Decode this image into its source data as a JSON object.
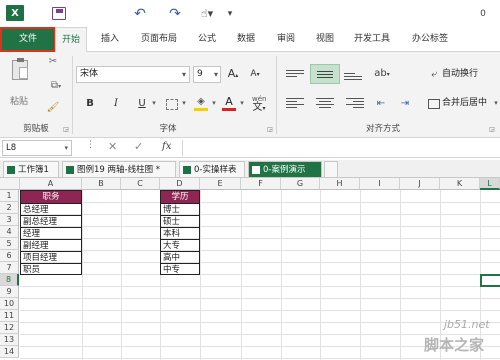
{
  "app": {
    "logo": "X",
    "qat_icons": [
      "save-icon",
      "undo-icon",
      "redo-icon",
      "touch-mode-icon",
      "customize-qat-icon"
    ],
    "qat_right": "0"
  },
  "tabs": [
    {
      "label": "文件"
    },
    {
      "label": "开始"
    },
    {
      "label": "插入"
    },
    {
      "label": "页面布局"
    },
    {
      "label": "公式"
    },
    {
      "label": "数据"
    },
    {
      "label": "审阅"
    },
    {
      "label": "视图"
    },
    {
      "label": "开发工具"
    },
    {
      "label": "办公标签"
    }
  ],
  "ribbon": {
    "clipboard": {
      "paste": "粘贴",
      "label": "剪贴板"
    },
    "font": {
      "name": "宋体",
      "size": "9",
      "grow": "A",
      "shrink": "A",
      "bold": "B",
      "italic": "I",
      "underline": "U",
      "wen": "wén",
      "color_a": "A",
      "label": "字体",
      "fill_color": "#f5d000",
      "font_color": "#e0201e"
    },
    "alignment": {
      "wrap": "自动换行",
      "merge": "合并后居中",
      "label": "对齐方式"
    }
  },
  "formula_bar": {
    "name_box": "L8",
    "fx": "fx",
    "value": ""
  },
  "sheet_tabs": [
    {
      "label": "工作簿1"
    },
    {
      "label": "图例19 两轴-线柱图 *"
    },
    {
      "label": "0-实操样表"
    },
    {
      "label": "0-案例演示"
    }
  ],
  "columns": [
    "A",
    "B",
    "C",
    "D",
    "E",
    "F",
    "G",
    "H",
    "I",
    "J",
    "K",
    "L"
  ],
  "rows": [
    "1",
    "2",
    "3",
    "4",
    "5",
    "6",
    "7",
    "8",
    "9",
    "10",
    "11",
    "12",
    "13",
    "14"
  ],
  "table_a": {
    "header": "职务",
    "items": [
      "总经理",
      "副总经理",
      "经理",
      "副经理",
      "项目经理",
      "职员"
    ]
  },
  "table_d": {
    "header": "学历",
    "items": [
      "博士",
      "硕士",
      "本科",
      "大专",
      "高中",
      "中专"
    ]
  },
  "watermark": {
    "line1": "jb51.net",
    "line2": "脚本之家"
  },
  "colors": {
    "accent": "#217346",
    "header_fill": "#8e2553"
  }
}
